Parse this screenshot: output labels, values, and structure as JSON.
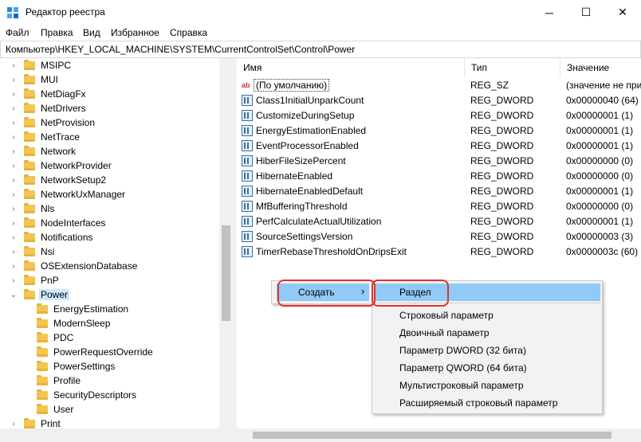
{
  "window": {
    "title": "Редактор реестра",
    "minimize": "─",
    "maximize": "☐",
    "close": "✕"
  },
  "menu": [
    "Файл",
    "Правка",
    "Вид",
    "Избранное",
    "Справка"
  ],
  "address": "Компьютер\\HKEY_LOCAL_MACHINE\\SYSTEM\\CurrentControlSet\\Control\\Power",
  "tree": [
    {
      "label": "MSIPC",
      "level": 1
    },
    {
      "label": "MUI",
      "level": 1
    },
    {
      "label": "NetDiagFx",
      "level": 1
    },
    {
      "label": "NetDrivers",
      "level": 1
    },
    {
      "label": "NetProvision",
      "level": 1
    },
    {
      "label": "NetTrace",
      "level": 1
    },
    {
      "label": "Network",
      "level": 1
    },
    {
      "label": "NetworkProvider",
      "level": 1
    },
    {
      "label": "NetworkSetup2",
      "level": 1
    },
    {
      "label": "NetworkUxManager",
      "level": 1
    },
    {
      "label": "Nls",
      "level": 1
    },
    {
      "label": "NodeInterfaces",
      "level": 1
    },
    {
      "label": "Notifications",
      "level": 1
    },
    {
      "label": "Nsi",
      "level": 1
    },
    {
      "label": "OSExtensionDatabase",
      "level": 1
    },
    {
      "label": "PnP",
      "level": 1
    },
    {
      "label": "Power",
      "level": 1,
      "expanded": true,
      "selected": true
    },
    {
      "label": "EnergyEstimation",
      "level": 2
    },
    {
      "label": "ModernSleep",
      "level": 2
    },
    {
      "label": "PDC",
      "level": 2
    },
    {
      "label": "PowerRequestOverride",
      "level": 2
    },
    {
      "label": "PowerSettings",
      "level": 2
    },
    {
      "label": "Profile",
      "level": 2
    },
    {
      "label": "SecurityDescriptors",
      "level": 2
    },
    {
      "label": "User",
      "level": 2
    },
    {
      "label": "Print",
      "level": 1
    }
  ],
  "columns": {
    "name": "Имя",
    "type": "Тип",
    "value": "Значение"
  },
  "values": [
    {
      "name": "(По умолчанию)",
      "type": "REG_SZ",
      "value": "(значение не присвоено)",
      "icon": "string-value-icon"
    },
    {
      "name": "Class1InitialUnparkCount",
      "type": "REG_DWORD",
      "value": "0x00000040 (64)",
      "icon": "binary-value-icon"
    },
    {
      "name": "CustomizeDuringSetup",
      "type": "REG_DWORD",
      "value": "0x00000001 (1)",
      "icon": "binary-value-icon"
    },
    {
      "name": "EnergyEstimationEnabled",
      "type": "REG_DWORD",
      "value": "0x00000001 (1)",
      "icon": "binary-value-icon"
    },
    {
      "name": "EventProcessorEnabled",
      "type": "REG_DWORD",
      "value": "0x00000001 (1)",
      "icon": "binary-value-icon"
    },
    {
      "name": "HiberFileSizePercent",
      "type": "REG_DWORD",
      "value": "0x00000000 (0)",
      "icon": "binary-value-icon"
    },
    {
      "name": "HibernateEnabled",
      "type": "REG_DWORD",
      "value": "0x00000000 (0)",
      "icon": "binary-value-icon"
    },
    {
      "name": "HibernateEnabledDefault",
      "type": "REG_DWORD",
      "value": "0x00000001 (1)",
      "icon": "binary-value-icon"
    },
    {
      "name": "MfBufferingThreshold",
      "type": "REG_DWORD",
      "value": "0x00000000 (0)",
      "icon": "binary-value-icon"
    },
    {
      "name": "PerfCalculateActualUtilization",
      "type": "REG_DWORD",
      "value": "0x00000001 (1)",
      "icon": "binary-value-icon"
    },
    {
      "name": "SourceSettingsVersion",
      "type": "REG_DWORD",
      "value": "0x00000003 (3)",
      "icon": "binary-value-icon"
    },
    {
      "name": "TimerRebaseThresholdOnDripsExit",
      "type": "REG_DWORD",
      "value": "0x0000003c (60)",
      "icon": "binary-value-icon"
    }
  ],
  "context_menu": {
    "create": "Создать",
    "arrow": "›"
  },
  "submenu": {
    "key": "Раздел",
    "items": [
      "Строковый параметр",
      "Двоичный параметр",
      "Параметр DWORD (32 бита)",
      "Параметр QWORD (64 бита)",
      "Мультистроковый параметр",
      "Расширяемый строковый параметр"
    ]
  },
  "colors": {
    "highlight": "#91c9f7",
    "annotation": "#e0322c",
    "selection": "#cce8ff"
  }
}
